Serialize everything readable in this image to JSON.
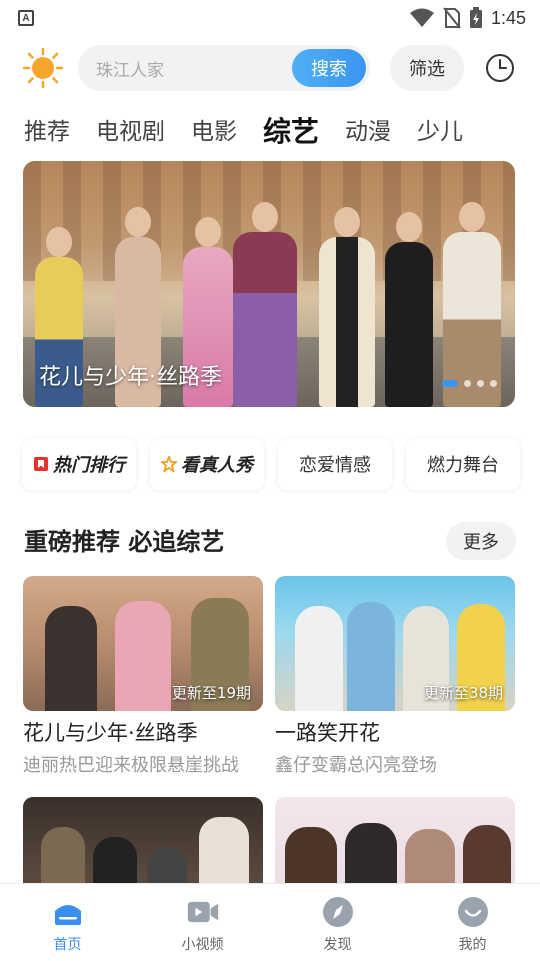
{
  "status_bar": {
    "time": "1:45",
    "left_badge": "A"
  },
  "search": {
    "placeholder": "珠江人家",
    "button": "搜索",
    "filter": "筛选"
  },
  "tabs": [
    {
      "label": "推荐",
      "active": false
    },
    {
      "label": "电视剧",
      "active": false
    },
    {
      "label": "电影",
      "active": false
    },
    {
      "label": "综艺",
      "active": true
    },
    {
      "label": "动漫",
      "active": false
    },
    {
      "label": "少儿",
      "active": false
    }
  ],
  "banner": {
    "title": "花儿与少年·丝路季"
  },
  "chips": [
    {
      "label": "热门排行",
      "icon": "bookmark-icon"
    },
    {
      "label": "看真人秀",
      "icon": "star-icon"
    },
    {
      "label": "恋爱情感"
    },
    {
      "label": "燃力舞台"
    }
  ],
  "section": {
    "title": "重磅推荐 必追综艺",
    "more": "更多"
  },
  "cards": [
    {
      "name": "花儿与少年·丝路季",
      "desc": "迪丽热巴迎来极限悬崖挑战",
      "update": "更新至19期"
    },
    {
      "name": "一路笑开花",
      "desc": "鑫仔变霸总闪亮登场",
      "update": "更新至38期"
    },
    {
      "name": "",
      "desc": "",
      "update": ""
    },
    {
      "name": "",
      "desc": "",
      "update": ""
    }
  ],
  "bottom_nav": [
    {
      "label": "首页",
      "icon": "home-icon",
      "active": true
    },
    {
      "label": "小视频",
      "icon": "video-icon",
      "active": false
    },
    {
      "label": "发现",
      "icon": "compass-icon",
      "active": false
    },
    {
      "label": "我的",
      "icon": "profile-icon",
      "active": false
    }
  ],
  "colors": {
    "accent": "#3a95ef",
    "text": "#222222",
    "muted": "#999999"
  }
}
